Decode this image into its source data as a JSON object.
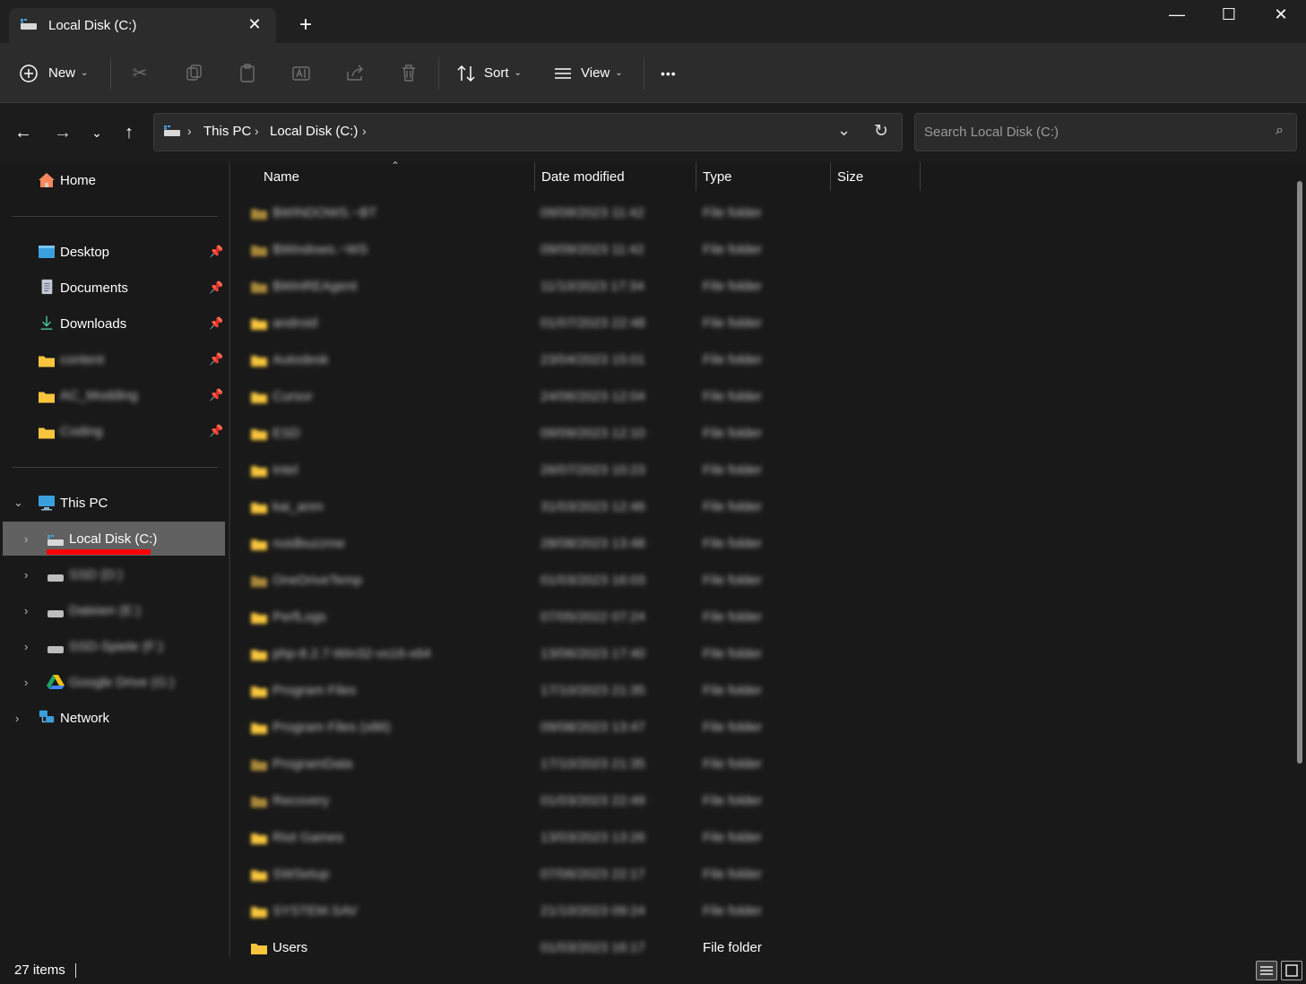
{
  "window": {
    "tab_title": "Local Disk (C:)",
    "tab_close": "✕",
    "new_tab": "+",
    "minimize": "—",
    "maximize": "☐",
    "close": "✕"
  },
  "toolbar": {
    "new_label": "New",
    "sort_label": "Sort",
    "view_label": "View",
    "more_label": "•••",
    "icons": [
      "cut-icon",
      "copy-icon",
      "paste-icon",
      "rename-icon",
      "share-icon",
      "delete-icon"
    ]
  },
  "address": {
    "crumbs": [
      "This PC",
      "Local Disk (C:)"
    ],
    "search_placeholder": "Search Local Disk (C:)"
  },
  "sidebar": {
    "home": "Home",
    "quick_access": [
      {
        "label": "Desktop",
        "icon": "desktop-icon"
      },
      {
        "label": "Documents",
        "icon": "documents-icon"
      },
      {
        "label": "Downloads",
        "icon": "downloads-icon"
      },
      {
        "label": "content",
        "icon": "folder-icon"
      },
      {
        "label": "AC_Modding",
        "icon": "folder-icon"
      },
      {
        "label": "Coding",
        "icon": "folder-icon"
      }
    ],
    "this_pc": "This PC",
    "drives": [
      {
        "label": "Local Disk (C:)",
        "selected": true
      },
      {
        "label": "SSD (D:)"
      },
      {
        "label": "Dateien (E:)"
      },
      {
        "label": "SSD-Spiele (F:)"
      },
      {
        "label": "Google Drive (G:)"
      }
    ],
    "network": "Network"
  },
  "columns": {
    "name": "Name",
    "date": "Date modified",
    "type": "Type",
    "size": "Size"
  },
  "files": [
    {
      "name": "$WINDOWS.~BT",
      "date": "09/09/2023 11:42",
      "type": "File folder",
      "faded": true
    },
    {
      "name": "$Windows.~WS",
      "date": "09/09/2023 11:42",
      "type": "File folder",
      "faded": true
    },
    {
      "name": "$WinREAgent",
      "date": "11/10/2023 17:34",
      "type": "File folder",
      "faded": true
    },
    {
      "name": "android",
      "date": "01/07/2023 22:48",
      "type": "File folder"
    },
    {
      "name": "Autodesk",
      "date": "23/04/2023 15:01",
      "type": "File folder"
    },
    {
      "name": "Cursor",
      "date": "24/06/2023 12:04",
      "type": "File folder"
    },
    {
      "name": "ESD",
      "date": "09/09/2023 12:10",
      "type": "File folder"
    },
    {
      "name": "Intel",
      "date": "26/07/2023 10:23",
      "type": "File folder"
    },
    {
      "name": "kai_anm",
      "date": "31/03/2023 12:46",
      "type": "File folder"
    },
    {
      "name": "noidbuzzme",
      "date": "28/08/2023 13:48",
      "type": "File folder"
    },
    {
      "name": "OneDriveTemp",
      "date": "01/03/2023 16:03",
      "type": "File folder",
      "faded": true
    },
    {
      "name": "PerfLogs",
      "date": "07/05/2022 07:24",
      "type": "File folder"
    },
    {
      "name": "php-8.2.7-Win32-vs16-x64",
      "date": "13/06/2023 17:40",
      "type": "File folder"
    },
    {
      "name": "Program Files",
      "date": "17/10/2023 21:35",
      "type": "File folder"
    },
    {
      "name": "Program Files (x86)",
      "date": "09/08/2023 13:47",
      "type": "File folder"
    },
    {
      "name": "ProgramData",
      "date": "17/10/2023 21:35",
      "type": "File folder",
      "faded": true
    },
    {
      "name": "Recovery",
      "date": "01/03/2023 22:49",
      "type": "File folder",
      "faded": true
    },
    {
      "name": "Riot Games",
      "date": "13/03/2023 13:26",
      "type": "File folder"
    },
    {
      "name": "SWSetup",
      "date": "07/06/2023 22:17",
      "type": "File folder"
    },
    {
      "name": "SYSTEM.SAV",
      "date": "21/10/2023 09:24",
      "type": "File folder"
    },
    {
      "name": "Users",
      "date": "01/03/2023 16:17",
      "type": "File folder",
      "visible": true
    }
  ],
  "status": {
    "items": "27 items"
  },
  "colors": {
    "folder": "#f8c53d",
    "folder_faded": "#a8873a",
    "highlight": "#ff0000",
    "selected_bg": "#616161"
  }
}
